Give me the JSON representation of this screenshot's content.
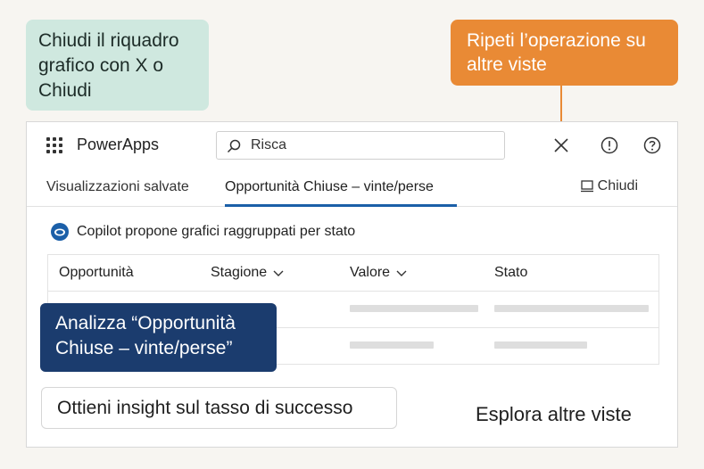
{
  "callouts": {
    "close_hint": "Chiudi il riquadro grafico con X o Chiudi",
    "repeat_hint": "Ripeti l’operazione su altre viste",
    "analyze_hint": "Analizza “Opportunità Chiuse – vinte/perse”"
  },
  "app": {
    "title": "PowerApps",
    "search": {
      "value": "Risca"
    }
  },
  "tabs": [
    {
      "label": "Visualizzazioni salvate"
    },
    {
      "label": "Opportunità Chiuse – vinte/perse"
    }
  ],
  "close_tab": {
    "label": "Chiudi"
  },
  "copilot": {
    "message": "Copilot propone grafici raggruppati per stato"
  },
  "table": {
    "columns": [
      "Opportunità",
      "Stagione",
      "Valore",
      "Stato"
    ]
  },
  "actions": {
    "insight_button": "Ottieni insight sul tasso di successo",
    "explore_link": "Esplora altre viste"
  },
  "colors": {
    "accent_blue": "#1b5fa8",
    "callout_orange": "#e98a35",
    "callout_green": "#cfe8df",
    "callout_navy": "#1b3c6e"
  },
  "icons": [
    "app-launcher-icon",
    "search-icon",
    "close-icon",
    "alert-icon",
    "help-icon",
    "chart-pane-icon",
    "copilot-icon",
    "chevron-down-icon"
  ]
}
